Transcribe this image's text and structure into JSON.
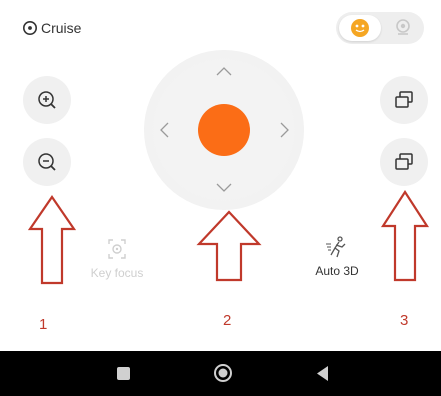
{
  "header": {
    "title": "Cruise",
    "toggle": {
      "selected_icon": "emoji-face-icon",
      "other_icon": "robot-icon",
      "accent": "#f5a623"
    }
  },
  "controls": {
    "zoom_in_icon": "zoom-in-icon",
    "zoom_out_icon": "zoom-out-icon",
    "dpad_center_color": "#fb6d16",
    "right_buttons": [
      "layers-icon",
      "layers-icon"
    ]
  },
  "features": {
    "key_focus": {
      "label": "Key focus",
      "enabled": false
    },
    "auto_3d": {
      "label": "Auto 3D",
      "enabled": true
    }
  },
  "annotations": {
    "color": "#c0392b",
    "labels": [
      "1",
      "2",
      "3"
    ]
  },
  "navbar": {
    "buttons": [
      "square-icon",
      "circle-icon",
      "back-triangle-icon"
    ]
  }
}
